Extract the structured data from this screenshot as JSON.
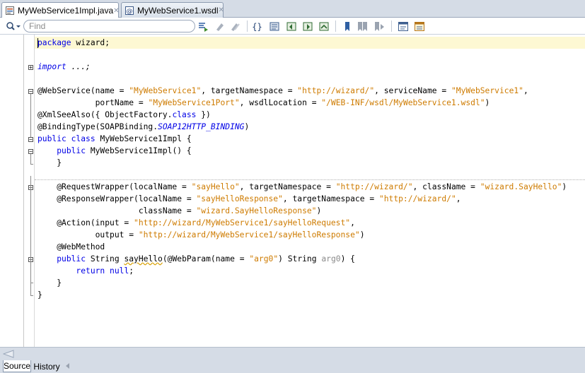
{
  "tabs": [
    {
      "label": "MyWebService1Impl.java",
      "icon": "java-file-icon",
      "active": true
    },
    {
      "label": "MyWebService1.wsdl",
      "icon": "wsdl-file-icon",
      "active": false
    }
  ],
  "toolbar": {
    "search_placeholder": "Find",
    "buttons": [
      "last-edit-icon",
      "previous-occurrence-icon",
      "next-occurrence-icon",
      "toggle-highlight-icon",
      "find-selection-icon",
      "find-previous-icon",
      "find-next-icon",
      "toggle-bookmark-icon",
      "previous-bookmark-icon",
      "next-bookmark-icon",
      "shift-left-icon",
      "shift-right-icon",
      "macro-icon"
    ]
  },
  "code": {
    "l01": {
      "a": "package",
      "b": " wizard;"
    },
    "l03": {
      "a": "import",
      "b": " ...;"
    },
    "l05": {
      "a": "@WebService(name = ",
      "b": "\"MyWebService1\"",
      "c": ", targetNamespace = ",
      "d": "\"http://wizard/\"",
      "e": ", serviceName = ",
      "f": "\"MyWebService1\"",
      "g": ","
    },
    "l06": {
      "a": "            portName = ",
      "b": "\"MyWebService1Port\"",
      "c": ", wsdlLocation = ",
      "d": "\"/WEB-INF/wsdl/MyWebService1.wsdl\"",
      "e": ")"
    },
    "l07": {
      "a": "@XmlSeeAlso({ ObjectFactory.",
      "b": "class",
      "c": " })"
    },
    "l08": {
      "a": "@BindingType(SOAPBinding.",
      "b": "SOAP12HTTP_BINDING",
      "c": ")"
    },
    "l09": {
      "a": "public",
      "b": " ",
      "c": "class",
      "d": " MyWebService1Impl {"
    },
    "l10": {
      "a": "    ",
      "b": "public",
      "c": " MyWebService1Impl() {"
    },
    "l11": {
      "a": "    }"
    },
    "l13": {
      "a": "    @RequestWrapper(localName = ",
      "b": "\"sayHello\"",
      "c": ", targetNamespace = ",
      "d": "\"http://wizard/\"",
      "e": ", className = ",
      "f": "\"wizard.SayHello\"",
      "g": ")"
    },
    "l14": {
      "a": "    @ResponseWrapper(localName = ",
      "b": "\"sayHelloResponse\"",
      "c": ", targetNamespace = ",
      "d": "\"http://wizard/\"",
      "e": ","
    },
    "l15": {
      "a": "                     className = ",
      "b": "\"wizard.SayHelloResponse\"",
      "c": ")"
    },
    "l16": {
      "a": "    @Action(input = ",
      "b": "\"http://wizard/MyWebService1/sayHelloRequest\"",
      "c": ","
    },
    "l17": {
      "a": "            output = ",
      "b": "\"http://wizard/MyWebService1/sayHelloResponse\"",
      "c": ")"
    },
    "l18": {
      "a": "    @WebMethod"
    },
    "l19": {
      "a": "    ",
      "b": "public",
      "c": " String ",
      "d": "sayHello",
      "e": "(@WebParam(name = ",
      "f": "\"arg0\"",
      "g": ") String ",
      "h": "arg0",
      "i": ") {"
    },
    "l20": {
      "a": "        ",
      "b": "return",
      "c": " ",
      "d": "null",
      "e": ";"
    },
    "l21": {
      "a": "    }"
    },
    "l22": {
      "a": "}"
    }
  },
  "bottom_tabs": [
    {
      "label": "Source",
      "active": true
    },
    {
      "label": "History",
      "active": false
    }
  ]
}
